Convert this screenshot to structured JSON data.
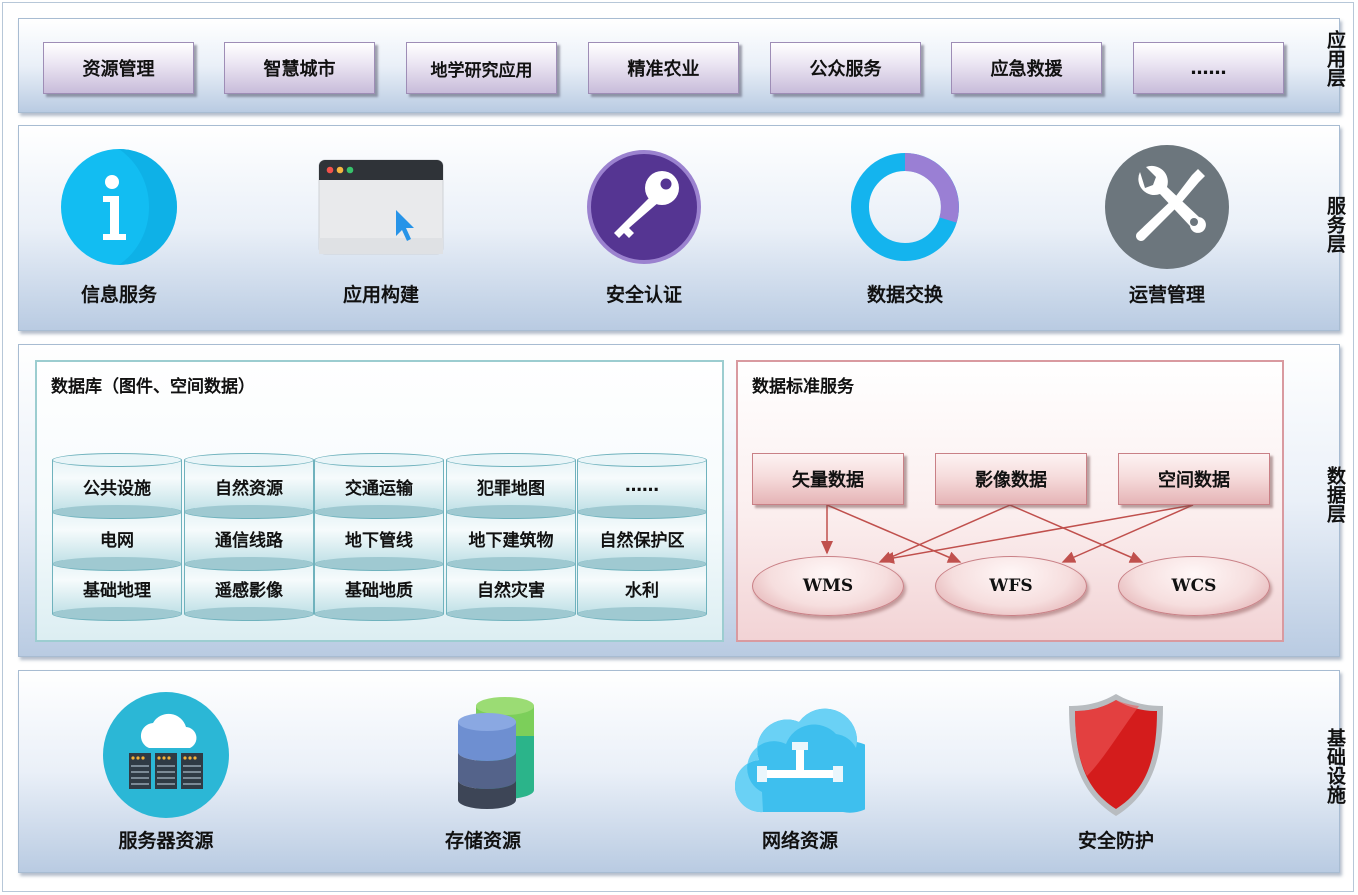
{
  "layers": {
    "application": "应用层",
    "service": "服务层",
    "data": "数据层",
    "infrastructure": "基础设施"
  },
  "applications": [
    "资源管理",
    "智慧城市",
    "地学研究应用",
    "精准农业",
    "公众服务",
    "应急救援",
    "……"
  ],
  "services": [
    {
      "label": "信息服务",
      "icon": "info-icon"
    },
    {
      "label": "应用构建",
      "icon": "browser-window-icon"
    },
    {
      "label": "安全认证",
      "icon": "key-icon"
    },
    {
      "label": "数据交换",
      "icon": "ring-chart-icon"
    },
    {
      "label": "运营管理",
      "icon": "tools-icon"
    }
  ],
  "database": {
    "title": "数据库（图件、空间数据）",
    "rows": [
      [
        "公共设施",
        "自然资源",
        "交通运输",
        "犯罪地图",
        "……"
      ],
      [
        "电网",
        "通信线路",
        "地下管线",
        "地下建筑物",
        "自然保护区"
      ],
      [
        "基础地理",
        "遥感影像",
        "基础地质",
        "自然灾害",
        "水利"
      ]
    ]
  },
  "standard_services": {
    "title": "数据标准服务",
    "sources": [
      "矢量数据",
      "影像数据",
      "空间数据"
    ],
    "targets": [
      "WMS",
      "WFS",
      "WCS"
    ]
  },
  "infrastructure": [
    {
      "label": "服务器资源",
      "icon": "server-cloud-icon"
    },
    {
      "label": "存储资源",
      "icon": "database-stack-icon"
    },
    {
      "label": "网络资源",
      "icon": "network-cloud-icon"
    },
    {
      "label": "安全防护",
      "icon": "shield-icon"
    }
  ],
  "colors": {
    "info": "#12bdf2",
    "key": "#553592",
    "ring_main": "#14b4ee",
    "ring_accent": "#9a7fd4",
    "tools": "#6c767d",
    "arrow": "#c0504d",
    "shield": "#d41c1c"
  }
}
